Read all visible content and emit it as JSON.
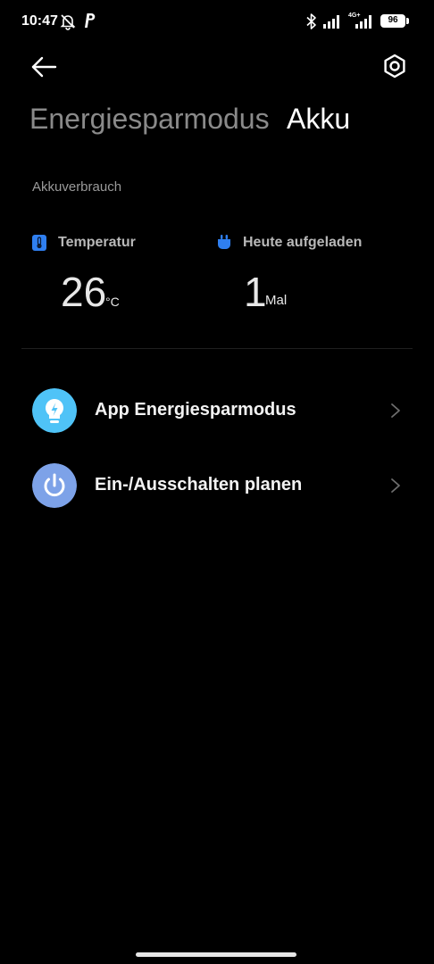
{
  "status_bar": {
    "time": "10:47",
    "network_label": "4G+",
    "battery_level": "96"
  },
  "header": {
    "tabs": [
      {
        "label": "Energiesparmodus",
        "active": false
      },
      {
        "label": "Akku",
        "active": true
      }
    ]
  },
  "usage": {
    "section_label": "Akkuverbrauch",
    "temperature": {
      "label": "Temperatur",
      "value": "26",
      "unit": "°C"
    },
    "charged_today": {
      "label": "Heute aufgeladen",
      "value": "1",
      "unit": "Mal"
    }
  },
  "menu": {
    "items": [
      {
        "label": "App Energiesparmodus",
        "icon": "lightbulb-bolt-icon",
        "color": "#4fc3f7"
      },
      {
        "label": "Ein-/Ausschalten planen",
        "icon": "power-icon",
        "color": "#7da2e8"
      }
    ]
  },
  "colors": {
    "background": "#000000",
    "accent_blue": "#2f7ff0"
  }
}
